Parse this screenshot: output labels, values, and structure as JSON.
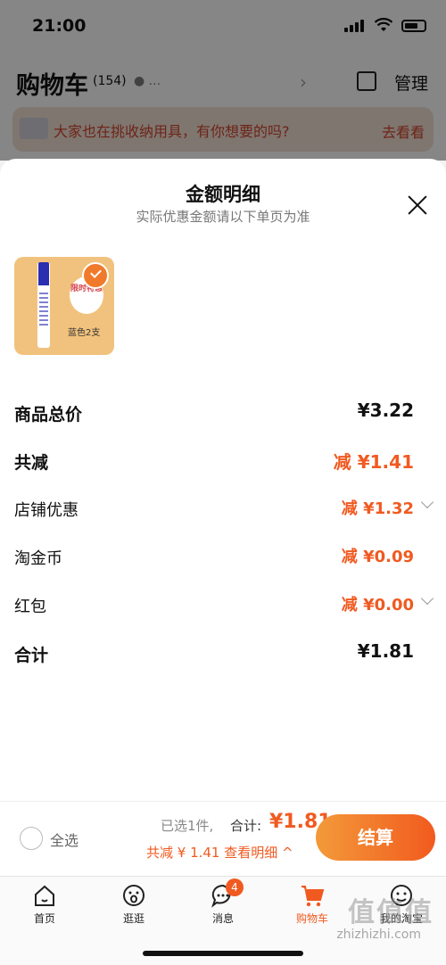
{
  "status": {
    "time": "21:00"
  },
  "cart": {
    "title": "购物车",
    "count": "(154)",
    "location": "...",
    "manage": "管理"
  },
  "banner": {
    "text": "大家也在挑收纳用具，有你想要的吗?",
    "link": "去看看"
  },
  "sheet": {
    "title": "金额明细",
    "subtitle": "实际优惠金额请以下单页为准",
    "product": {
      "promo": "限时特惠",
      "variant": "蓝色2支"
    },
    "rows": [
      {
        "label": "商品总价",
        "value": "¥3.22"
      },
      {
        "label": "共减",
        "value": "减 ¥1.41"
      },
      {
        "label": "店铺优惠",
        "value": "减 ¥1.32"
      },
      {
        "label": "淘金币",
        "value": "减 ¥0.09"
      },
      {
        "label": "红包",
        "value": "减 ¥0.00"
      },
      {
        "label": "合计",
        "value": "¥1.81"
      }
    ]
  },
  "checkout": {
    "select_all": "全选",
    "selected_info": "已选1件,",
    "total_label": "合计:",
    "total_value": "¥1.81",
    "reduced": "共减 ¥ 1.41  查看明细 ^",
    "pay": "结算"
  },
  "tabs": [
    {
      "label": "首页",
      "icon": "home-icon"
    },
    {
      "label": "逛逛",
      "icon": "explore-icon"
    },
    {
      "label": "消息",
      "icon": "message-icon",
      "badge": "4"
    },
    {
      "label": "购物车",
      "icon": "cart-icon"
    },
    {
      "label": "我的淘宝",
      "icon": "profile-icon"
    }
  ],
  "watermark": {
    "text": "值值值",
    "site": "zhizhizhi.com"
  },
  "colors": {
    "accent": "#f05a20",
    "pay_gradient_start": "#f39a3a"
  }
}
